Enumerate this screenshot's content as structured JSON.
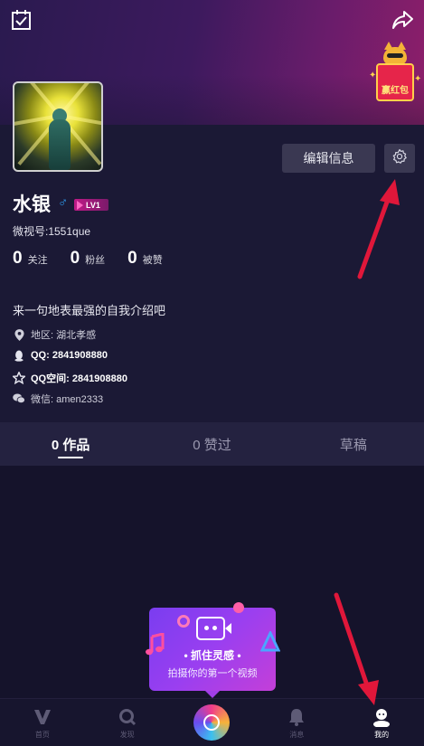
{
  "colors": {
    "accent": "#e0173a",
    "hero_start": "#2a1a4f",
    "hero_end": "#8e1f6a",
    "gender": "#2f9cf0",
    "level_badge": "#c01a87"
  },
  "header": {
    "left_icon": "checklist-icon",
    "right_icon": "share-icon"
  },
  "red_packet": {
    "label": "赢红包"
  },
  "profile": {
    "username": "水银",
    "gender_symbol": "♂",
    "level": "LV1",
    "weishi_id": "微视号:1551que",
    "edit_label": "编辑信息",
    "settings_icon": "gear-icon",
    "stats": [
      {
        "value": "0",
        "label": "关注"
      },
      {
        "value": "0",
        "label": "粉丝"
      },
      {
        "value": "0",
        "label": "被赞"
      }
    ],
    "bio": "来一句地表最强的自我介绍吧",
    "info": {
      "location": "地区: 湖北孝感",
      "qq": "QQ: 2841908880",
      "qzone": "QQ空间: 2841908880",
      "wechat": "微信: amen2333"
    }
  },
  "tabs": [
    {
      "label": "0 作品",
      "active": true
    },
    {
      "label": "0 赞过",
      "active": false
    },
    {
      "label": "草稿",
      "active": false
    }
  ],
  "cta": {
    "title": "• 抓住灵感 •",
    "subtitle": "拍摄你的第一个视频"
  },
  "bottom_nav": [
    {
      "label": "首页",
      "icon": "v-logo-icon",
      "active": false
    },
    {
      "label": "发现",
      "icon": "search-icon",
      "active": false
    },
    {
      "label": "",
      "icon": "camera-record-icon",
      "active": false
    },
    {
      "label": "消息",
      "icon": "bell-icon",
      "active": false
    },
    {
      "label": "我的",
      "icon": "profile-icon",
      "active": true
    }
  ]
}
